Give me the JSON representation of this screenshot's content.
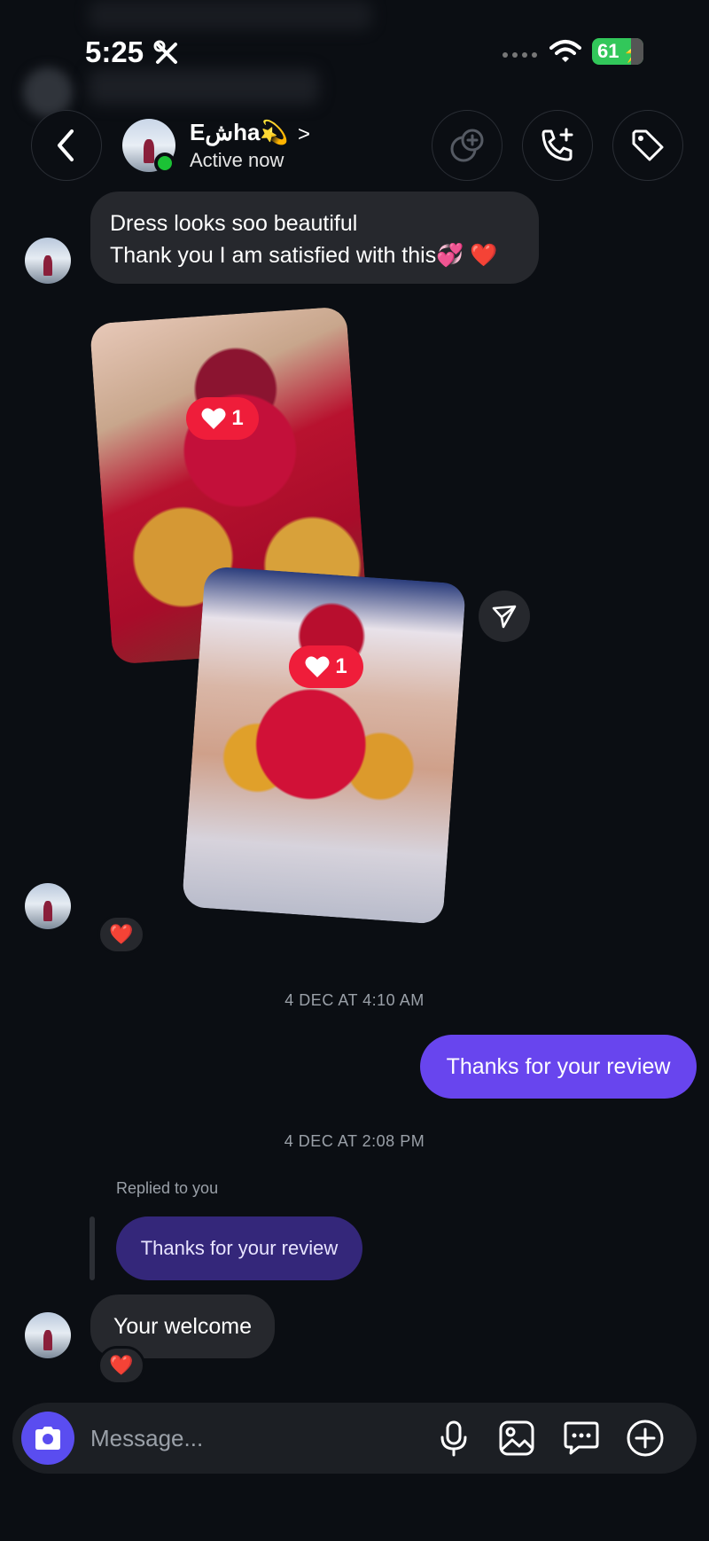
{
  "status_bar": {
    "time": "5:25",
    "battery": "61"
  },
  "header": {
    "contact_name": "Eشha💫",
    "name_chevron": ">",
    "contact_status": "Active now"
  },
  "messages": {
    "first_line1": "Dress looks soo beautiful",
    "first_line2": "Thank you I am satisfied with this💞 ❤️",
    "photo1_reaction": "1",
    "photo2_reaction": "1",
    "photos_mini_reaction": "❤️",
    "timestamp1": "4 DEC AT 4:10 AM",
    "outgoing1": "Thanks for your review",
    "timestamp2": "4 DEC AT 2:08 PM",
    "replied_label": "Replied to you",
    "quoted_text": "Thanks for your review",
    "last_incoming": "Your welcome",
    "last_reaction": "❤️"
  },
  "composer": {
    "placeholder": "Message..."
  },
  "icons": [
    "back-icon",
    "sticker-add-icon",
    "call-add-icon",
    "tag-icon",
    "share-icon",
    "camera-icon",
    "microphone-icon",
    "gallery-icon",
    "message-icon",
    "plus-icon"
  ],
  "colors": {
    "outgoing": "#6845ee",
    "quoted": "#34277a",
    "incoming": "#26282d",
    "reaction": "#ef1d3a",
    "online": "#1bc235"
  }
}
